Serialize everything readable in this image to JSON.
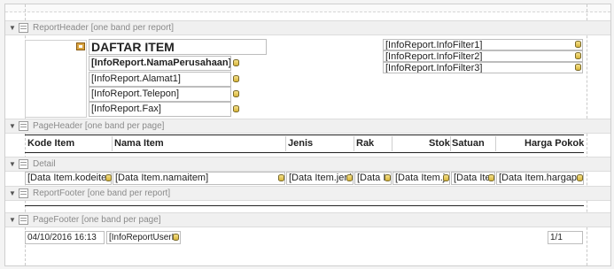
{
  "bands": {
    "report_header": "ReportHeader [one band per report]",
    "page_header": "PageHeader [one band per page]",
    "detail": "Detail",
    "report_footer": "ReportFooter [one band per report]",
    "page_footer": "PageFooter [one band per page]"
  },
  "report_header": {
    "title": "DAFTAR ITEM",
    "company": "[InfoReport.NamaPerusahaan]",
    "address": "[InfoReport.Alamat1]",
    "phone": "[InfoReport.Telepon]",
    "fax": "[InfoReport.Fax]",
    "filter1": "[InfoReport.InfoFilter1]",
    "filter2": "[InfoReport.InfoFilter2]",
    "filter3": "[InfoReport.InfoFilter3]"
  },
  "columns": [
    "Kode Item",
    "Nama Item",
    "Jenis",
    "Rak",
    "Stok",
    "Satuan",
    "Harga Pokok"
  ],
  "detail_fields": [
    "[Data Item.kodeitem",
    "[Data Item.namaitem]",
    "[Data Item.jeni",
    "[Data It",
    "[Data Item.jr",
    "[Data Iter",
    "[Data Item.hargapo"
  ],
  "page_footer": {
    "date": "04/10/2016 16:13",
    "user": "[InfoReportUserL",
    "page": "1/1"
  },
  "icons": {
    "collapse": "triangle-down-icon",
    "band": "band-icon",
    "datafield": "database-icon",
    "picture": "picture-icon"
  },
  "colors": {
    "band_bg": "#f0f0f0",
    "band_text": "#8a8a8a",
    "field_border": "#bdbdbd",
    "db_icon": "#d7b43a"
  }
}
